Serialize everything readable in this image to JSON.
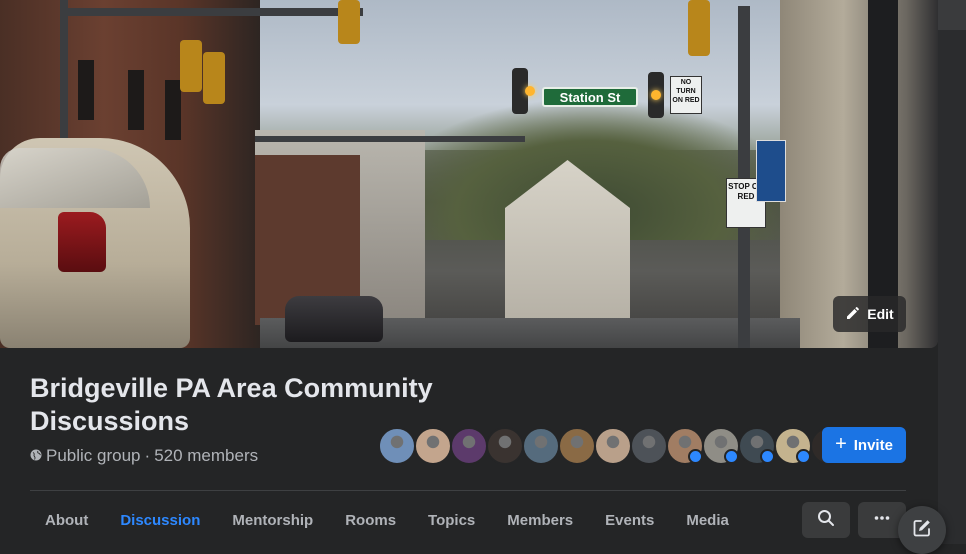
{
  "cover": {
    "street_sign": "Station St",
    "no_turn_sign": "NO TURN ON RED",
    "stop_sign": "STOP ON RED",
    "edit_label": "Edit"
  },
  "group": {
    "title": "Bridgeville PA Area Community Discussions",
    "privacy": "Public group",
    "separator": "·",
    "members": "520 members"
  },
  "invite": {
    "label": "Invite",
    "icon": "plus-icon"
  },
  "avatars": [
    {
      "color": "#6f8fb8",
      "badge": false
    },
    {
      "color": "#c3a58d",
      "badge": false
    },
    {
      "color": "#5c3a6b",
      "badge": false
    },
    {
      "color": "#3a3330",
      "badge": false
    },
    {
      "color": "#556b7d",
      "badge": false
    },
    {
      "color": "#8a6a45",
      "badge": false
    },
    {
      "color": "#b9a08a",
      "badge": false
    },
    {
      "color": "#4d5258",
      "badge": false
    },
    {
      "color": "#a17d63",
      "badge": true
    },
    {
      "color": "#8f8d86",
      "badge": true
    },
    {
      "color": "#3f4a52",
      "badge": true
    },
    {
      "color": "#c4b38e",
      "badge": true
    },
    {
      "color": "#2f2a28",
      "badge": false
    }
  ],
  "tabs": [
    {
      "label": "About",
      "active": false
    },
    {
      "label": "Discussion",
      "active": true
    },
    {
      "label": "Mentorship",
      "active": false
    },
    {
      "label": "Rooms",
      "active": false
    },
    {
      "label": "Topics",
      "active": false
    },
    {
      "label": "Members",
      "active": false
    },
    {
      "label": "Events",
      "active": false
    },
    {
      "label": "Media",
      "active": false
    }
  ],
  "icons": {
    "edit": "pencil-icon",
    "privacy": "globe-icon",
    "search": "search-icon",
    "more": "more-dots-icon",
    "compose": "compose-icon"
  },
  "colors": {
    "accent": "#2d88ff",
    "button": "#1b74e4",
    "background": "#242526"
  }
}
